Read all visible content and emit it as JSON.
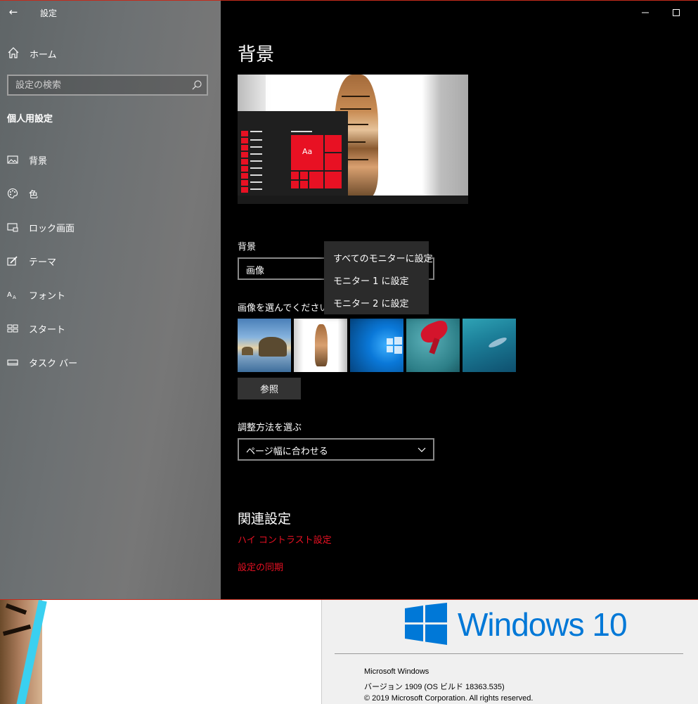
{
  "window": {
    "title": "設定",
    "back_icon": "back-arrow-icon"
  },
  "sidebar": {
    "home_label": "ホーム",
    "search_placeholder": "設定の検索",
    "section_heading": "個人用設定",
    "items": [
      {
        "label": "背景",
        "icon": "picture-icon"
      },
      {
        "label": "色",
        "icon": "palette-icon"
      },
      {
        "label": "ロック画面",
        "icon": "lock-screen-icon"
      },
      {
        "label": "テーマ",
        "icon": "theme-brush-icon"
      },
      {
        "label": "フォント",
        "icon": "font-icon"
      },
      {
        "label": "スタート",
        "icon": "start-grid-icon"
      },
      {
        "label": "タスク バー",
        "icon": "taskbar-icon"
      }
    ]
  },
  "main": {
    "page_title": "背景",
    "preview_tile_text": "Aa",
    "background_label": "背景",
    "background_value": "画像",
    "choose_picture_label": "画像を選んでください",
    "thumbnails": [
      {
        "name": "beach-rocks-thumbnail"
      },
      {
        "name": "tiger-thumbnail"
      },
      {
        "name": "windows-blue-thumbnail"
      },
      {
        "name": "red-flower-thumbnail"
      },
      {
        "name": "underwater-swimmer-thumbnail"
      }
    ],
    "browse_label": "参照",
    "fit_label": "調整方法を選ぶ",
    "fit_value": "ページ幅に合わせる",
    "related_title": "関連設定",
    "links": [
      "ハイ コントラスト設定",
      "設定の同期"
    ]
  },
  "context_menu": {
    "items": [
      "すべてのモニターに設定",
      "モニター 1 に設定",
      "モニター 2 に設定"
    ]
  },
  "winver": {
    "wordmark": "Windows 10",
    "lines": [
      "Microsoft Windows",
      "バージョン 1909 (OS ビルド 18363.535)",
      "© 2019 Microsoft Corporation. All rights reserved."
    ]
  },
  "colors": {
    "accent": "#e81123",
    "windows_blue": "#0078d7"
  }
}
